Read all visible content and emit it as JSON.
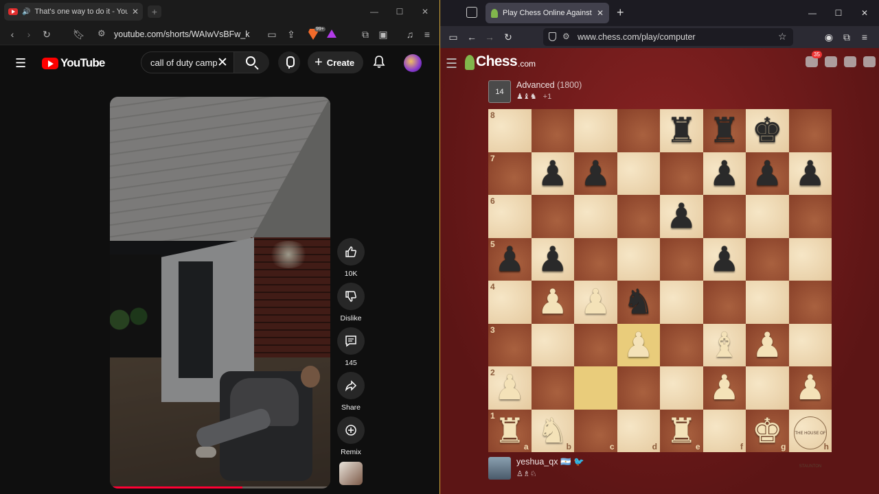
{
  "left_window": {
    "tab": {
      "title": "That's one way to do it - YouTube"
    },
    "window_controls": {
      "minimize": "—",
      "maximize": "☐",
      "close": "✕"
    },
    "url": "youtube.com/shorts/WAIwVsBFw_k",
    "brave_badge": "99+",
    "youtube": {
      "logo_text": "YouTube",
      "search": {
        "value": "call of duty campaign"
      },
      "create_label": "Create"
    },
    "shorts": {
      "progress_fraction": 0.6,
      "actions": [
        {
          "name": "like",
          "label": "10K"
        },
        {
          "name": "dislike",
          "label": "Dislike"
        },
        {
          "name": "comments",
          "label": "145"
        },
        {
          "name": "share",
          "label": "Share"
        },
        {
          "name": "remix",
          "label": "Remix"
        }
      ]
    }
  },
  "right_window": {
    "tab": {
      "title": "Play Chess Online Against the Computer"
    },
    "url": "www.chess.com/play/computer",
    "chess": {
      "logo_word": "Chess",
      "logo_domain": ".com",
      "notification_count": "35",
      "opponent": {
        "avatar_label": "14",
        "name": "Advanced",
        "rating": "(1800)",
        "captured": "♟♝♞",
        "captured_extra": "+1"
      },
      "player": {
        "name": "yeshua_qx",
        "flags": "🇦🇷 🐦",
        "captured": "♙♗♘"
      },
      "watermark": "THE HOUSE OF STAUNTON",
      "ranks": [
        "8",
        "7",
        "6",
        "5",
        "4",
        "3",
        "2",
        "1"
      ],
      "files": [
        "a",
        "b",
        "c",
        "d",
        "e",
        "f",
        "g",
        "h"
      ],
      "board": [
        [
          "",
          "",
          "",
          "",
          "r",
          "r",
          "k",
          ""
        ],
        [
          "",
          "p",
          "p",
          "",
          "",
          "p",
          "p",
          "p"
        ],
        [
          "",
          "",
          "",
          "",
          "p",
          "",
          "",
          ""
        ],
        [
          "p",
          "p",
          "",
          "",
          "",
          "p",
          "",
          ""
        ],
        [
          "",
          "P",
          "P",
          "n",
          "",
          "",
          "",
          ""
        ],
        [
          "",
          "",
          "",
          "P",
          "",
          "B",
          "P",
          ""
        ],
        [
          "P",
          "",
          "",
          "",
          "",
          "P",
          "",
          "P"
        ],
        [
          "R",
          "N",
          "",
          "",
          "R",
          "",
          "K",
          ""
        ]
      ],
      "highlight_squares": [
        "c2",
        "d3"
      ]
    }
  }
}
